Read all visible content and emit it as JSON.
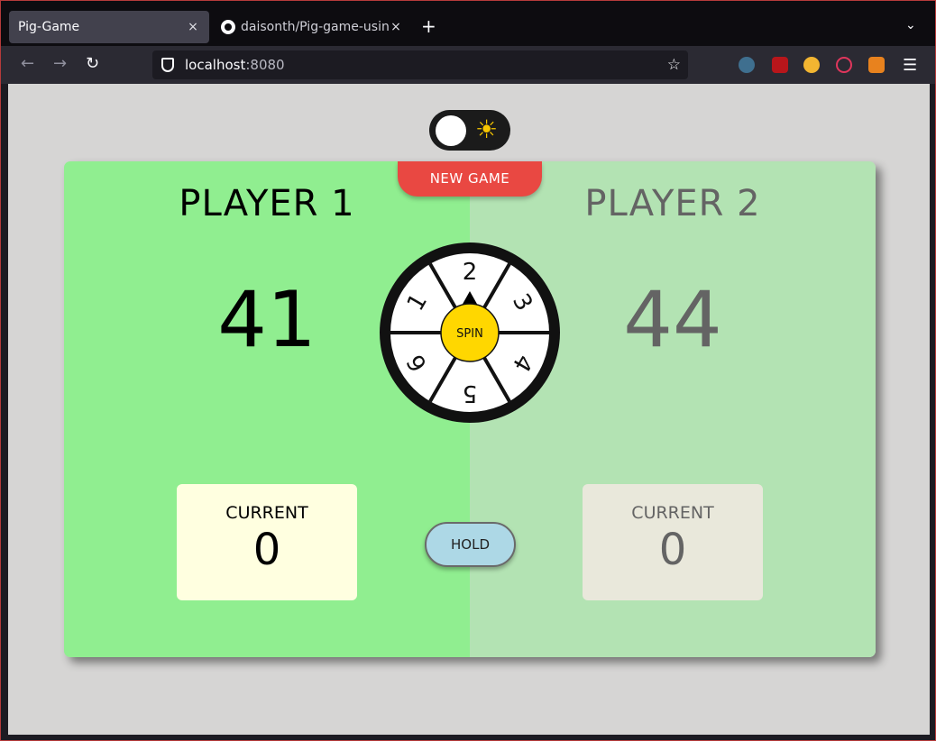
{
  "browser": {
    "tabs": [
      {
        "title": "Pig-Game",
        "active": true
      },
      {
        "title": "daisonth/Pig-game-using",
        "active": false
      }
    ],
    "url_host": "localhost",
    "url_port": ":8080",
    "close_glyph": "×",
    "newtab_glyph": "+"
  },
  "game": {
    "new_game_label": "NEW GAME",
    "hold_label": "HOLD",
    "spin_label": "SPIN",
    "theme_toggle": "light",
    "players": [
      {
        "name": "PLAYER 1",
        "score": "41",
        "current_label": "CURRENT",
        "current": "0",
        "active": true
      },
      {
        "name": "PLAYER 2",
        "score": "44",
        "current_label": "CURRENT",
        "current": "0",
        "active": false
      }
    ],
    "wheel_numbers": [
      "2",
      "3",
      "4",
      "5",
      "6",
      "1"
    ],
    "wheel_selected": "2"
  },
  "colors": {
    "active_player_bg": "#90ee90",
    "inactive_player_bg": "#b3e3b3",
    "new_game_bg": "#e94842",
    "hold_bg": "#add8e6",
    "spin_bg": "#ffd700"
  }
}
